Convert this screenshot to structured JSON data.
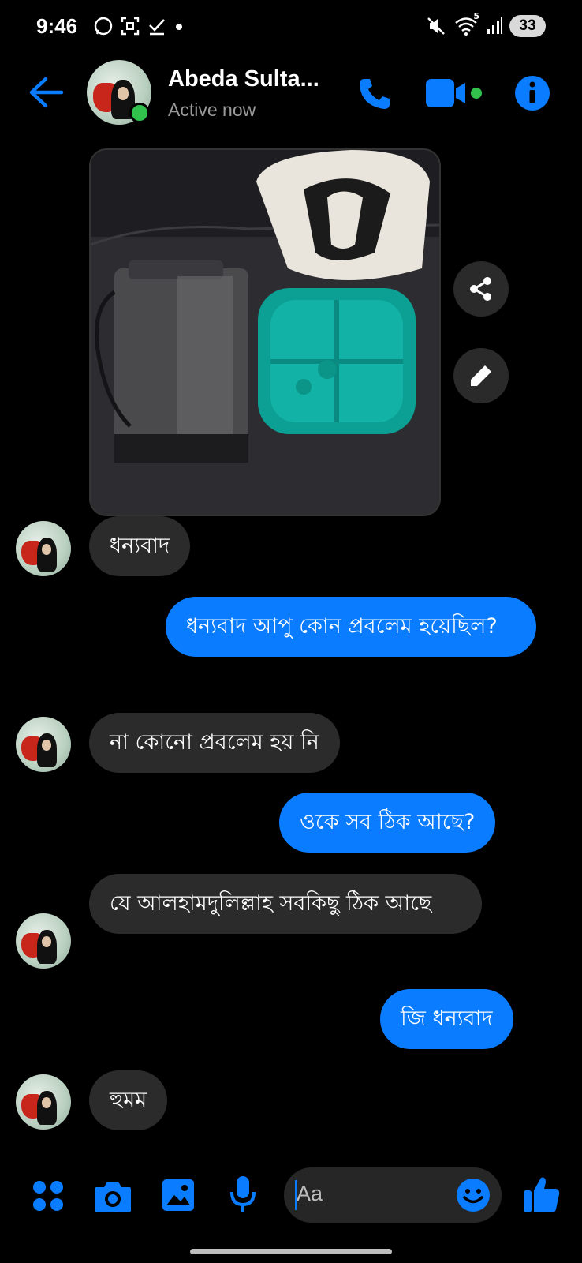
{
  "status_bar": {
    "time": "9:46",
    "battery": "33",
    "wifi_label": "5"
  },
  "header": {
    "name": "Abeda Sulta...",
    "status": "Active now"
  },
  "messages": [
    {
      "side": "in",
      "text": "ধন্যবাদ"
    },
    {
      "side": "out",
      "text": "ধন্যবাদ আপু কোন প্রবলেম হয়েছিল?"
    },
    {
      "side": "in",
      "text": "না কোনো প্রবলেম হয় নি"
    },
    {
      "side": "out",
      "text": "ওকে সব ঠিক আছে?"
    },
    {
      "side": "in",
      "text": "যে আলহামদুলিল্লাহ সবকিছু ঠিক আছে"
    },
    {
      "side": "out",
      "text": "জি ধন্যবাদ"
    },
    {
      "side": "in",
      "text": "হুমম"
    }
  ],
  "composer": {
    "placeholder": "Aa"
  },
  "colors": {
    "accent": "#0a7cff",
    "incoming_bubble": "#2b2b2b",
    "online": "#31c24d"
  },
  "icons": [
    "back-arrow-icon",
    "phone-icon",
    "video-icon",
    "info-icon",
    "share-icon",
    "edit-icon",
    "apps-icon",
    "camera-icon",
    "gallery-icon",
    "mic-icon",
    "emoji-icon",
    "thumbs-up-icon"
  ]
}
